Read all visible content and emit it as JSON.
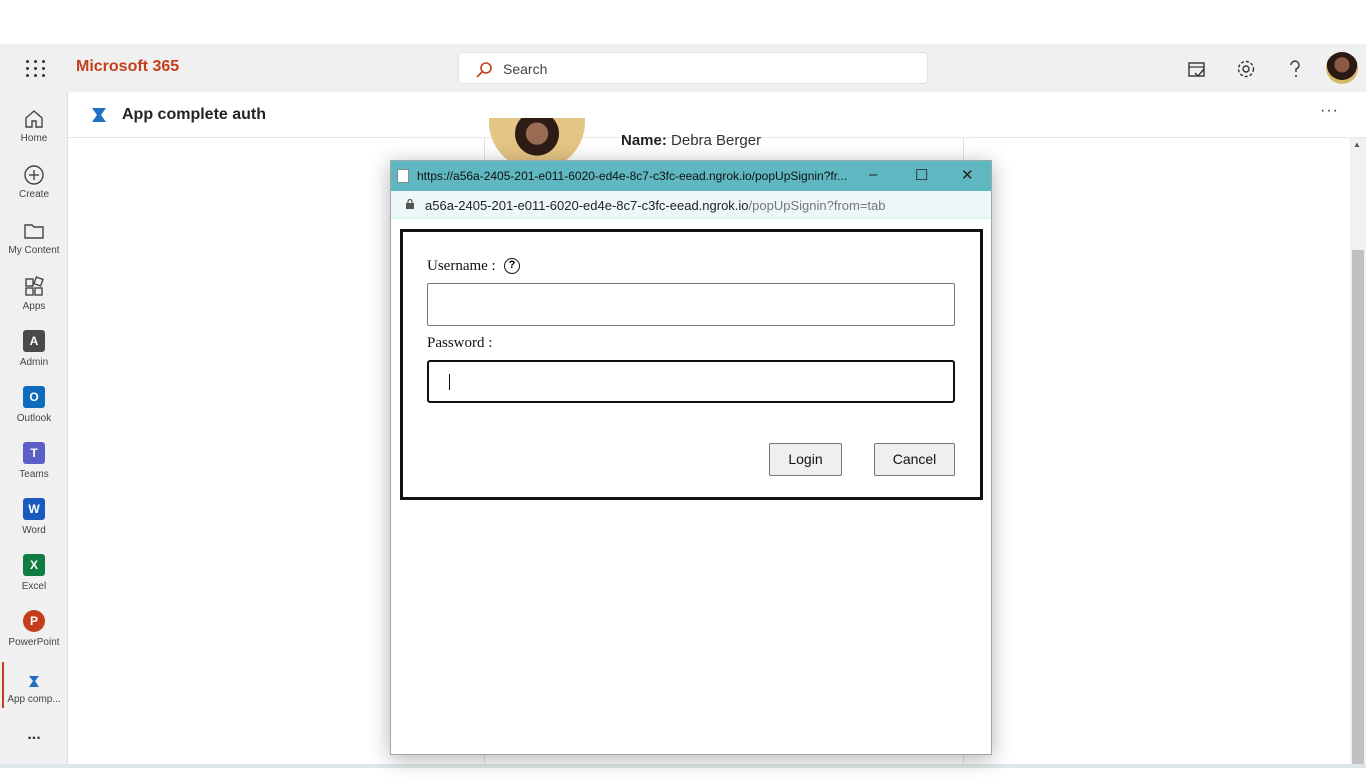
{
  "topbar": {
    "brand": "Microsoft 365",
    "search_placeholder": "Search",
    "icons": [
      "waffle-icon",
      "search-icon",
      "feedback-icon",
      "settings-icon",
      "help-icon",
      "avatar"
    ]
  },
  "rail": {
    "items": [
      {
        "label": "Home",
        "icon": "home-icon"
      },
      {
        "label": "Create",
        "icon": "create-icon"
      },
      {
        "label": "My Content",
        "icon": "folder-icon"
      },
      {
        "label": "Apps",
        "icon": "apps-icon"
      },
      {
        "label": "Admin",
        "icon": "admin-icon",
        "badge": "A"
      },
      {
        "label": "Outlook",
        "icon": "outlook-icon",
        "badge": "O",
        "color": "#0f6cbd"
      },
      {
        "label": "Teams",
        "icon": "teams-icon",
        "badge": "T",
        "color": "#5b5fc7"
      },
      {
        "label": "Word",
        "icon": "word-icon",
        "badge": "W",
        "color": "#185abd"
      },
      {
        "label": "Excel",
        "icon": "excel-icon",
        "badge": "X",
        "color": "#107c41"
      },
      {
        "label": "PowerPoint",
        "icon": "powerpoint-icon",
        "badge": "P",
        "color": "#c43e1c"
      },
      {
        "label": "App comp...",
        "icon": "app-complete-auth-icon",
        "active": true
      }
    ],
    "more": "..."
  },
  "app": {
    "title": "App complete auth",
    "more": "···"
  },
  "profile": {
    "name_label": "Name:",
    "name_value": "Debra Berger"
  },
  "popup": {
    "window_title": "https://a56a-2405-201-e011-6020-ed4e-8c7-c3fc-eead.ngrok.io/popUpSignin?fr...",
    "url_host": "a56a-2405-201-e011-6020-ed4e-8c7-c3fc-eead.ngrok.io",
    "url_path": "/popUpSignin?from=tab",
    "form": {
      "username_label": "Username :",
      "help_glyph": "?",
      "username_value": "",
      "password_label": "Password :",
      "login_label": "Login",
      "cancel_label": "Cancel"
    }
  },
  "colors": {
    "brand": "#c43e1c",
    "popup_titlebar": "#5fb8c1"
  }
}
